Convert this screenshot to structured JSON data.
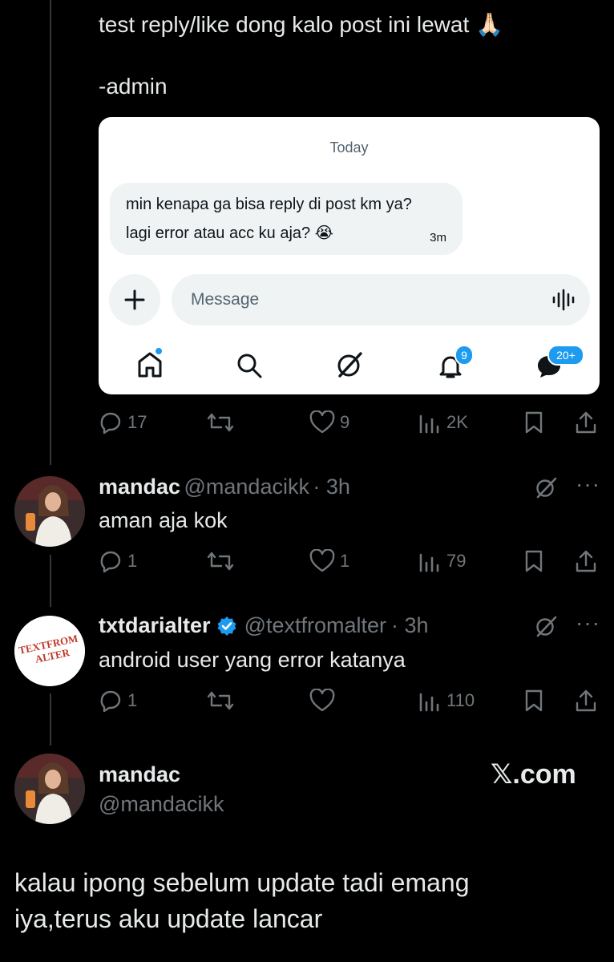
{
  "post": {
    "line1": "test reply/like dong kalo post ini lewat 🙏🏻",
    "line2": "-admin"
  },
  "dm_screenshot": {
    "date_label": "Today",
    "message_line1": "min kenapa ga bisa reply di post km ya?",
    "message_line2": "lagi error atau acc ku aja? 😭",
    "message_time": "3m",
    "composer_placeholder": "Message",
    "nav": {
      "home_icon": "home-icon",
      "search_icon": "search-icon",
      "grok_icon": "grok-icon",
      "notifications_badge": "9",
      "messages_badge": "20+"
    }
  },
  "post_actions": {
    "replies": "17",
    "reposts": "",
    "likes": "9",
    "views": "2K"
  },
  "replies": [
    {
      "name": "mandac",
      "handle": "@mandacikk",
      "time": "· 3h",
      "text": "aman aja kok",
      "actions": {
        "replies": "1",
        "reposts": "",
        "likes": "1",
        "views": "79"
      }
    },
    {
      "name": "txtdarialter",
      "verified": true,
      "handle": "@textfromalter",
      "time": "· 3h",
      "avatar_text_line1": "TEXTFROM",
      "avatar_text_line2": "ALTER",
      "text": "android user yang error katanya",
      "actions": {
        "replies": "1",
        "reposts": "",
        "likes": "",
        "views": "110"
      }
    }
  ],
  "footer": {
    "name": "mandac",
    "handle": "@mandacikk",
    "watermark": "𝕏.com",
    "text_line1": "kalau ipong sebelum update tadi emang",
    "text_line2": "iya,terus aku update lancar"
  },
  "colors": {
    "background": "#000000",
    "text": "#e7e9ea",
    "muted": "#71767b",
    "accent": "#1d9bf0"
  }
}
